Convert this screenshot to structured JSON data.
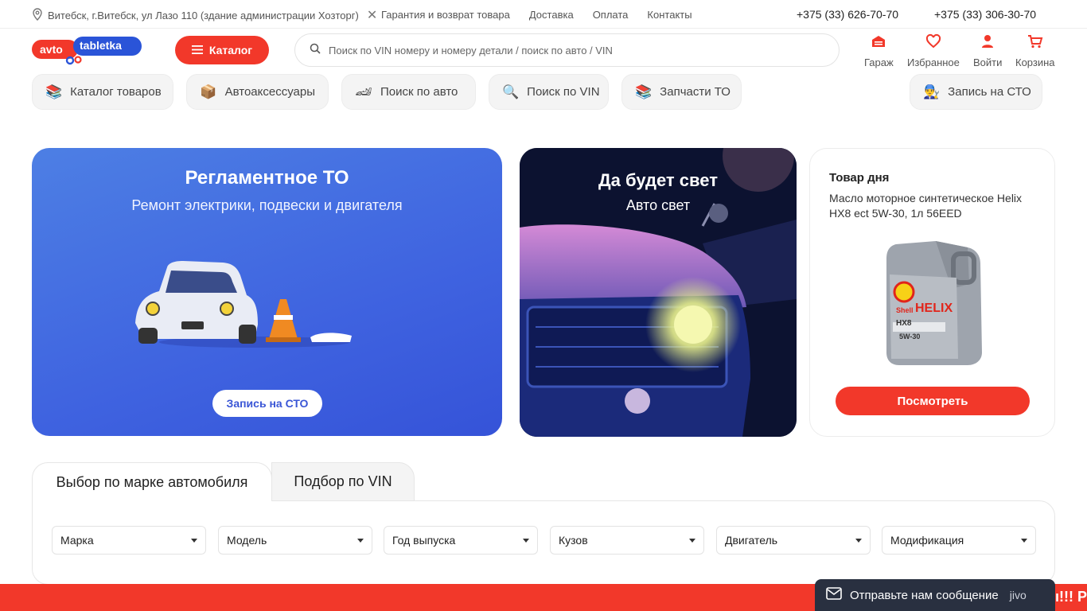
{
  "topbar": {
    "address": "Витебск, г.Витебск, ул Лазо 110 (здание администрации Хозторг)",
    "links": [
      "Гарантия и возврат товара",
      "Доставка",
      "Оплата",
      "Контакты"
    ],
    "phone1": "+375 (33) 626-70-70",
    "phone2": "+375 (33) 306-30-70"
  },
  "header": {
    "logo_left": "avto",
    "logo_right": "tabletka",
    "catalog_label": "Каталог",
    "search_placeholder": "Поиск по VIN номеру и номеру детали / поиск по авто / VIN",
    "icons": {
      "garage": "Гараж",
      "favorites": "Избранное",
      "login": "Войти",
      "cart": "Корзина"
    }
  },
  "quicknav": [
    {
      "label": "Каталог товаров",
      "icon": "books-icon"
    },
    {
      "label": "Автоаксессуары",
      "icon": "box-icon"
    },
    {
      "label": "Поиск по авто",
      "icon": "race-car-icon"
    },
    {
      "label": "Поиск по VIN",
      "icon": "magnifier-icon"
    },
    {
      "label": "Запчасти ТО",
      "icon": "books-icon"
    },
    {
      "label": "Запись на СТО",
      "icon": "mechanic-icon"
    }
  ],
  "banner1": {
    "title": "Регламентное ТО",
    "subtitle": "Ремонт электрики, подвески и двигателя",
    "button": "Запись на СТО"
  },
  "banner2": {
    "title": "Да будет свет",
    "subtitle": "Авто свет"
  },
  "deal": {
    "heading": "Товар дня",
    "product": "Масло моторное синтетическое Helix HX8 ect 5W-30, 1л 56EED",
    "button": "Посмотреть",
    "can_brand": "Shell",
    "can_line": "HELIX",
    "can_model": "HX8",
    "can_grade": "5W-30"
  },
  "tabs": {
    "by_brand": "Выбор по марке автомобиля",
    "by_vin": "Подбор по VIN"
  },
  "selects": [
    "Марка",
    "Модель",
    "Год выпуска",
    "Кузов",
    "Двигатель",
    "Модификация"
  ],
  "strip": {
    "text": "ы!!! Р"
  },
  "chat": {
    "text": "Отправьте нам сообщение",
    "brand": "jivo"
  },
  "colors": {
    "accent": "#f2382a",
    "banner_blue": "#4466e0",
    "chat_bg": "#293040"
  }
}
